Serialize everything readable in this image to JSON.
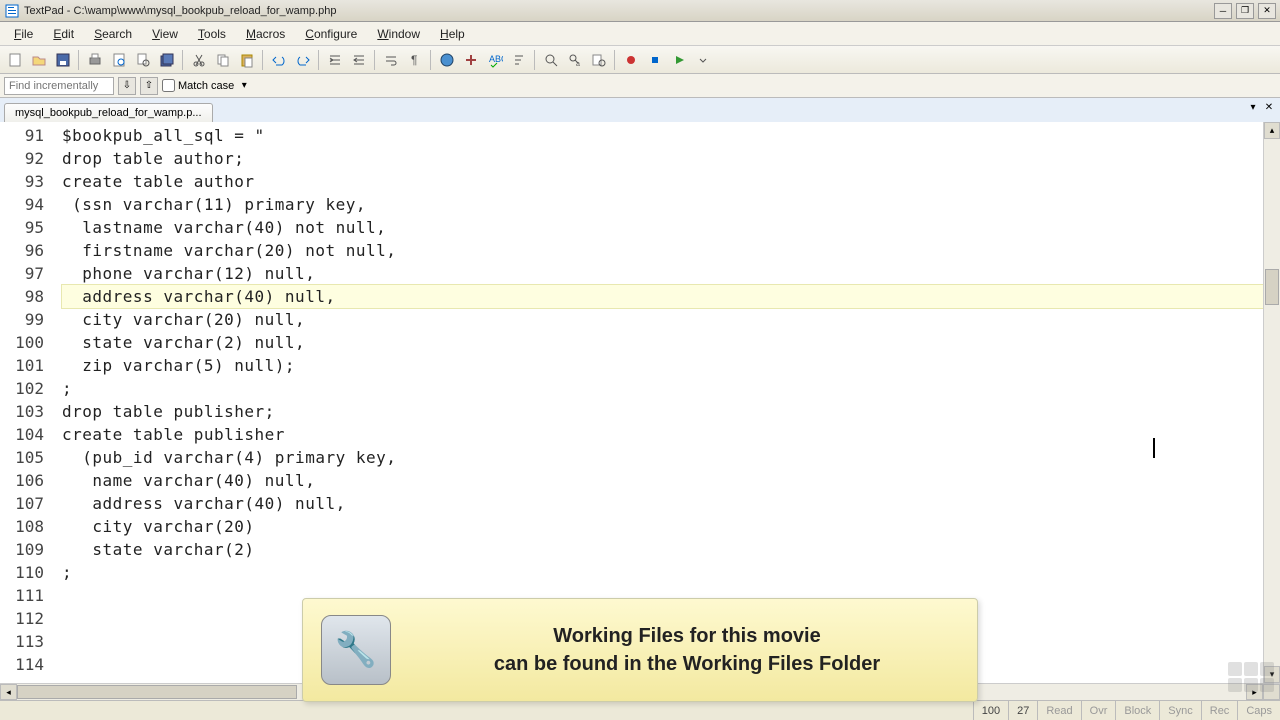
{
  "titlebar": {
    "text": "TextPad - C:\\wamp\\www\\mysql_bookpub_reload_for_wamp.php"
  },
  "menu": {
    "items": [
      "File",
      "Edit",
      "Search",
      "View",
      "Tools",
      "Macros",
      "Configure",
      "Window",
      "Help"
    ]
  },
  "findbar": {
    "placeholder": "Find incrementally",
    "match_case_label": "Match case"
  },
  "tabs": {
    "active": "mysql_bookpub_reload_for_wamp.p..."
  },
  "code": {
    "lines": [
      {
        "n": "91",
        "t": ""
      },
      {
        "n": "92",
        "t": "$bookpub_all_sql = \""
      },
      {
        "n": "93",
        "t": "drop table author;"
      },
      {
        "n": "94",
        "t": ""
      },
      {
        "n": "95",
        "t": "create table author"
      },
      {
        "n": "96",
        "t": " (ssn varchar(11) primary key,"
      },
      {
        "n": "97",
        "t": "  lastname varchar(40) not null,"
      },
      {
        "n": "98",
        "t": "  firstname varchar(20) not null,"
      },
      {
        "n": "99",
        "t": "  phone varchar(12) null,"
      },
      {
        "n": "100",
        "t": "  address varchar(40) null,",
        "hl": true
      },
      {
        "n": "101",
        "t": "  city varchar(20) null,"
      },
      {
        "n": "102",
        "t": "  state varchar(2) null,"
      },
      {
        "n": "103",
        "t": "  zip varchar(5) null);"
      },
      {
        "n": "104",
        "t": ";"
      },
      {
        "n": "105",
        "t": ""
      },
      {
        "n": "106",
        "t": "drop table publisher;"
      },
      {
        "n": "107",
        "t": ""
      },
      {
        "n": "108",
        "t": "create table publisher"
      },
      {
        "n": "109",
        "t": "  (pub_id varchar(4) primary key,"
      },
      {
        "n": "110",
        "t": "   name varchar(40) null,"
      },
      {
        "n": "111",
        "t": "   address varchar(40) null,"
      },
      {
        "n": "112",
        "t": "   city varchar(20)"
      },
      {
        "n": "113",
        "t": "   state varchar(2)"
      },
      {
        "n": "114",
        "t": ";"
      }
    ]
  },
  "status": {
    "line": "100",
    "col": "27",
    "read": "Read",
    "ovr": "Ovr",
    "block": "Block",
    "sync": "Sync",
    "rec": "Rec",
    "caps": "Caps"
  },
  "tooltip": {
    "line1": "Working Files for this movie",
    "line2": "can be found in the Working Files Folder"
  }
}
